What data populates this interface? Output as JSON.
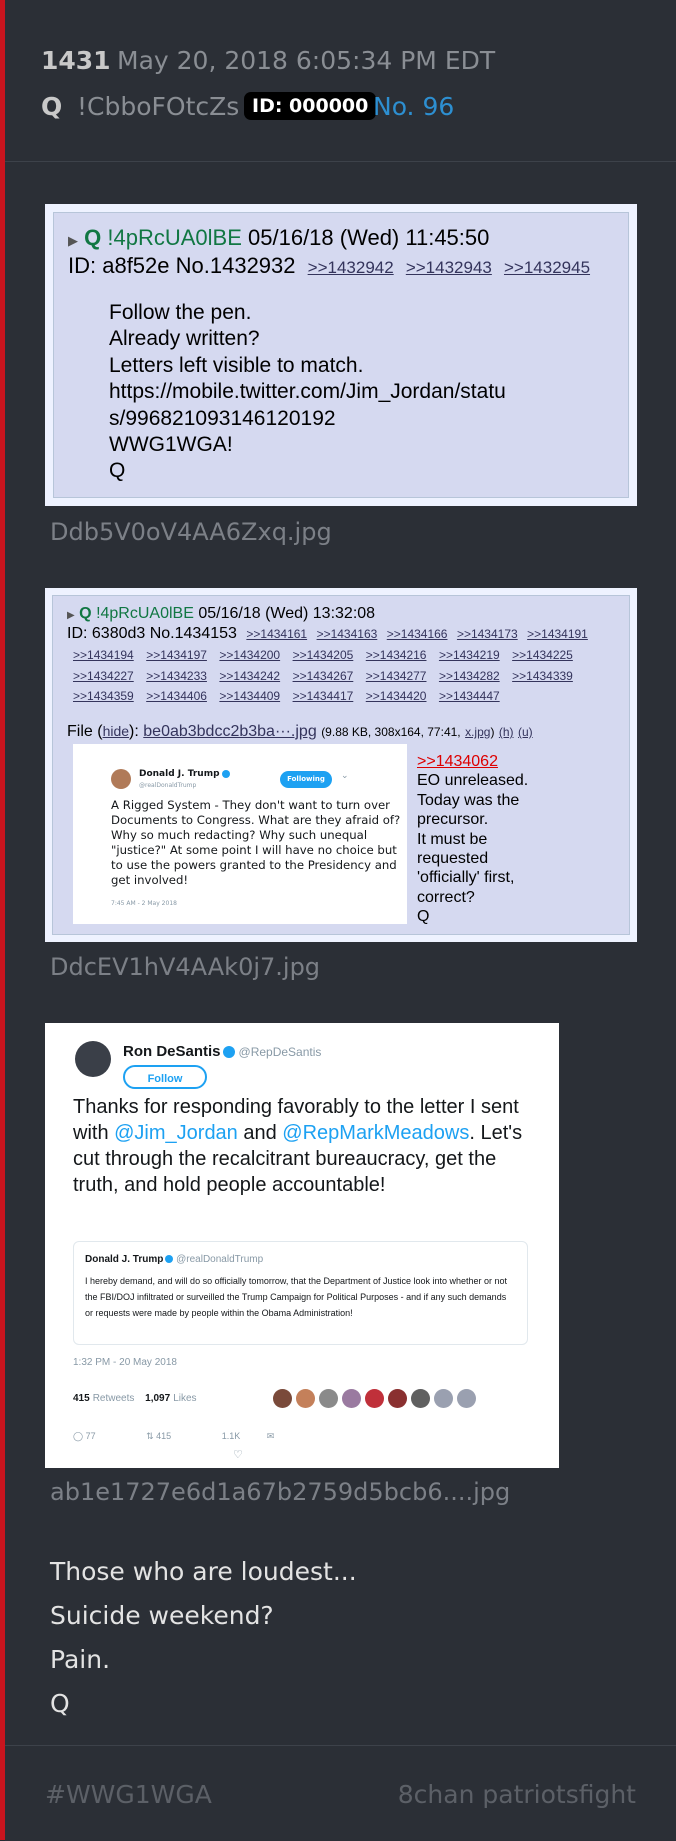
{
  "header": {
    "post_number": "1431",
    "date": "May 20, 2018 6:05:34 PM EDT",
    "q": "Q",
    "tripcode": "!CbboFOtcZs",
    "id_badge": "ID: 000000",
    "post_no": "No. 96"
  },
  "quote1": {
    "name": "Q",
    "trip": "!4pRcUA0lBE",
    "datetime": "05/16/18 (Wed) 11:45:50",
    "id_no": "ID: a8f52e No.1432932",
    "reply_links": [
      ">>1432942",
      ">>1432943",
      ">>1432945"
    ],
    "lines": [
      "Follow the pen.",
      "Already written?",
      "Letters left visible to match.",
      "https://mobile.twitter.com/Jim_Jordan/statu",
      "s/996821093146120192",
      "WWG1WGA!",
      "Q"
    ],
    "filename": "Ddb5V0oV4AA6Zxq.jpg"
  },
  "quote2": {
    "name": "Q",
    "trip": "!4pRcUA0lBE",
    "datetime": "05/16/18 (Wed) 13:32:08",
    "id_no": "ID: 6380d3 No.1434153",
    "reply_rows": [
      [
        ">>1434161",
        ">>1434163",
        ">>1434166",
        ">>1434173",
        ">>1434191"
      ],
      [
        ">>1434194",
        ">>1434197",
        ">>1434200",
        ">>1434205",
        ">>1434216",
        ">>1434219",
        ">>1434225"
      ],
      [
        ">>1434227",
        ">>1434233",
        ">>1434242",
        ">>1434267",
        ">>1434277",
        ">>1434282",
        ">>1434339"
      ],
      [
        ">>1434359",
        ">>1434406",
        ">>1434409",
        ">>1434417",
        ">>1434420",
        ">>1434447"
      ]
    ],
    "file_label": "File (",
    "hide": "hide",
    "file_sep": "):",
    "file_link": "be0ab3bdcc2b3ba···.jpg",
    "file_meta": "(9.88 KB, 308x164, 77:41,",
    "x": "x.jpg",
    "h": "(h)",
    "u": "(u)",
    "side_link": ">>1434062",
    "side_lines": [
      "EO unreleased.",
      "Today was the",
      "precursor.",
      "It must be",
      "requested",
      "'officially' first,",
      "correct?",
      "Q"
    ],
    "filename": "DdcEV1hV4AAk0j7.jpg",
    "tweet": {
      "name": "Donald J. Trump",
      "handle": "@realDonaldTrump",
      "follow": "Following",
      "text": "A Rigged System - They don't want to turn over Documents to Congress. What are they afraid of? Why so much redacting? Why such unequal \"justice?\" At some point I will have no choice but to use the powers granted to the Presidency and get involved!",
      "time": "7:45 AM - 2 May 2018"
    }
  },
  "tweet2": {
    "name": "Ron DeSantis",
    "handle": "@RepDeSantis",
    "follow": "Follow",
    "text_a": "Thanks for responding favorably to the letter I sent with ",
    "mention1": "@Jim_Jordan",
    "text_b": " and ",
    "mention2": "@RepMarkMeadows",
    "text_c": ". Let's cut through the recalcitrant bureaucracy, get the truth, and hold people accountable!",
    "quoted_name": "Donald J. Trump",
    "quoted_handle": "@realDonaldTrump",
    "quoted_text": "I hereby demand, and will do so officially tomorrow, that the Department of Justice look into whether or not the FBI/DOJ infiltrated or surveilled the Trump Campaign for Political Purposes - and if any such demands or requests were made by people within the Obama Administration!",
    "time": "1:32 PM - 20 May 2018",
    "retweets": "415",
    "retweets_label": "Retweets",
    "likes": "1,097",
    "likes_label": "Likes",
    "replies_count": "77",
    "rt_count": "415",
    "like_count": "1.1K",
    "filename": "ab1e1727e6d1a67b2759d5bcb6....jpg"
  },
  "body_lines": [
    "Those who are loudest...",
    "Suicide weekend?",
    "Pain.",
    "Q"
  ],
  "footer": {
    "hashtag": "#WWG1WGA",
    "board": "8chan patriotsfight"
  },
  "colors": {
    "accent_red": "#c8141e",
    "post_no_blue": "#2d8fd1",
    "q_green": "#117743",
    "twitter_blue": "#1da1f2"
  }
}
